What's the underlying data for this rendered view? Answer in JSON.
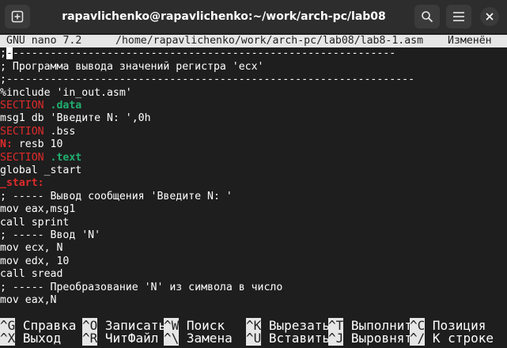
{
  "window": {
    "title": "rapavlichenko@rapavlichenko:~/work/arch-pc/lab08",
    "icons": [
      "new-tab-icon",
      "search-icon",
      "hamburger-menu-icon",
      "close-icon"
    ]
  },
  "nano": {
    "version": "GNU nano 7.2",
    "file_path": "/home/rapavlichenko/work/arch-pc/lab08/lab8-1.asm",
    "status": "Изменён"
  },
  "code": {
    "line1_start": ";",
    "line1_cursor": "-",
    "line1_rest": "-------------------------------------------------------------",
    "line2": "; Программа вывода значений регистра 'ecx'",
    "line3": ";-----------------------------------------------------------------",
    "line4": "%include 'in_out.asm'",
    "line5_kw": "SECTION",
    "line5_arg": " .data",
    "line6": "msg1 db 'Введите N: ',0h",
    "line7_kw": "SECTION",
    "line7_arg": " .bss",
    "line8_label": "N:",
    "line8_rest": " resb 10",
    "line9_kw": "SECTION",
    "line9_arg": " .text",
    "line10": "global _start",
    "line11": "_start:",
    "line12": "; ----- Вывод сообщения 'Введите N: '",
    "line13": "mov eax,msg1",
    "line14": "call sprint",
    "line15": "; ----- Ввод 'N'",
    "line16": "mov ecx, N",
    "line17": "mov edx, 10",
    "line18": "call sread",
    "line19": "; ----- Преобразование 'N' из символа в число",
    "line20": "mov eax,N"
  },
  "shortcuts": [
    {
      "key": "^G",
      "label": "Справка"
    },
    {
      "key": "^O",
      "label": "Записать"
    },
    {
      "key": "^W",
      "label": "Поиск"
    },
    {
      "key": "^K",
      "label": "Вырезать"
    },
    {
      "key": "^T",
      "label": "Выполнить"
    },
    {
      "key": "^C",
      "label": "Позиция"
    },
    {
      "key": "^X",
      "label": "Выход"
    },
    {
      "key": "^R",
      "label": "ЧитФайл"
    },
    {
      "key": "^\\",
      "label": "Замена"
    },
    {
      "key": "^U",
      "label": "Вставить"
    },
    {
      "key": "^J",
      "label": "Выровнять"
    },
    {
      "key": "^/",
      "label": "К строке"
    }
  ],
  "colors": {
    "keyword": "#e02b2b",
    "section_name": "#20b070",
    "background": "#1e1e1e"
  }
}
